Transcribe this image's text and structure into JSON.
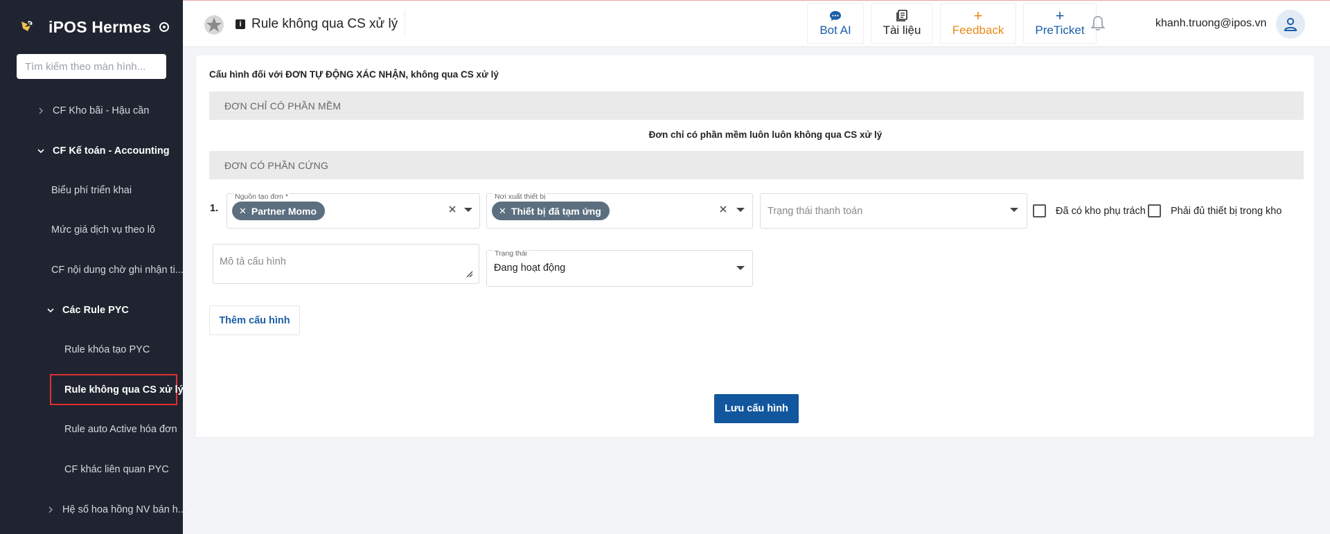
{
  "app": {
    "name": "iPOS Hermes",
    "search_placeholder": "Tìm kiếm theo màn hình..."
  },
  "sidebar": {
    "items": [
      {
        "label": "CF Kho bãi - Hậu cần"
      },
      {
        "label": "CF Kế toán - Accounting"
      },
      {
        "label": "Biểu phí triển khai"
      },
      {
        "label": "Mức giá dịch vụ theo lô"
      },
      {
        "label": "CF nội dung chờ ghi nhận ti..."
      },
      {
        "label": "Các Rule PYC"
      },
      {
        "label": "Rule khóa tạo PYC"
      },
      {
        "label": "Rule không qua CS xử lý"
      },
      {
        "label": "Rule auto Active hóa đơn"
      },
      {
        "label": "CF khác liên quan PYC"
      },
      {
        "label": "Hệ số hoa hồng NV bán h..."
      }
    ]
  },
  "header": {
    "page_title": "Rule không qua CS xử lý",
    "buttons": {
      "bot_ai": "Bot AI",
      "docs": "Tài liệu",
      "feedback": "Feedback",
      "preticket": "PreTicket"
    },
    "user_email": "khanh.truong@ipos.vn"
  },
  "content": {
    "title": "Cấu hình đối với ĐƠN TỰ ĐỘNG XÁC NHẬN, không qua CS xử lý",
    "section_software": "ĐƠN CHỈ CÓ PHẦN MỀM",
    "software_note": "Đơn chỉ có phần mềm luôn luôn không qua CS xử lý",
    "section_hardware": "ĐƠN CÓ PHẦN CỨNG",
    "row_number": "1.",
    "source_field": {
      "label": "Nguồn tạo đơn *",
      "chip": "Partner Momo"
    },
    "device_field": {
      "label": "Nơi xuất thiết bị",
      "chip": "Thiết bị đã tạm ứng"
    },
    "payment_field": {
      "placeholder": "Trạng thái thanh toán"
    },
    "checkbox_warehouse": "Đã có kho phụ trách",
    "checkbox_enough": "Phải đủ thiết bị trong kho",
    "description_placeholder": "Mô tả cấu hình",
    "status_field": {
      "label": "Trạng thái",
      "value": "Đang hoạt động"
    },
    "add_button": "Thêm cấu hình",
    "save_button": "Lưu cấu hình"
  },
  "colors": {
    "sidebar_bg": "#1f2430",
    "primary": "#12579e",
    "accent_orange": "#e88a1a",
    "chip_bg": "#5c6f80",
    "active_outline": "#e23030"
  }
}
